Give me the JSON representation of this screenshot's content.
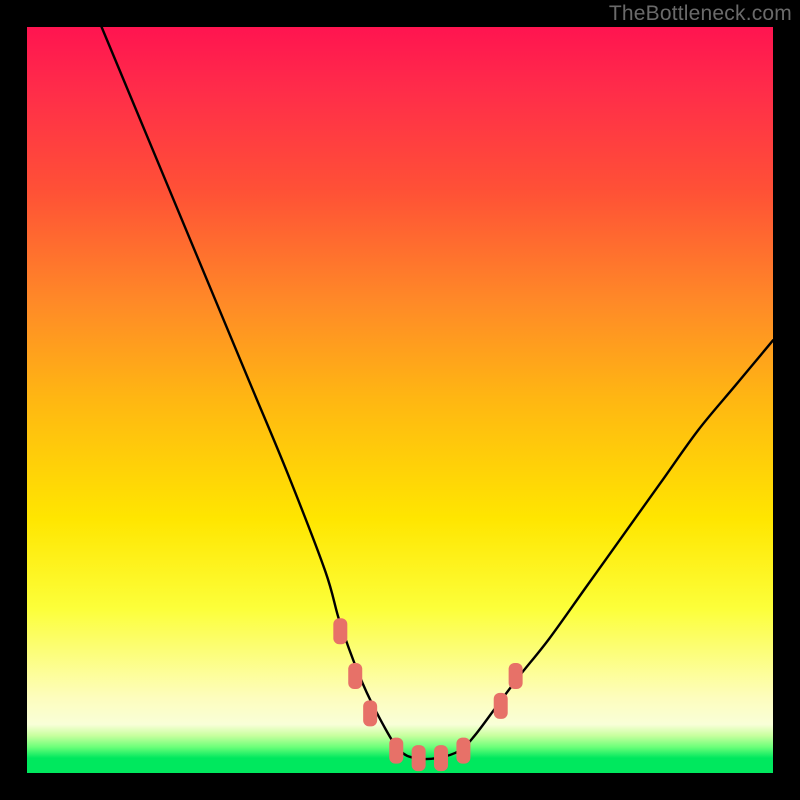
{
  "watermark": "TheBottleneck.com",
  "chart_data": {
    "type": "line",
    "title": "",
    "xlabel": "",
    "ylabel": "",
    "xlim": [
      0,
      100
    ],
    "ylim": [
      0,
      100
    ],
    "grid": false,
    "legend": false,
    "series": [
      {
        "name": "bottleneck-curve",
        "x": [
          10,
          15,
          20,
          25,
          30,
          35,
          40,
          42,
          45,
          48,
          50,
          52,
          55,
          58,
          60,
          63,
          66,
          70,
          75,
          80,
          85,
          90,
          95,
          100
        ],
        "y": [
          100,
          88,
          76,
          64,
          52,
          40,
          27,
          20,
          12,
          6,
          3,
          2,
          2,
          3,
          5,
          9,
          13,
          18,
          25,
          32,
          39,
          46,
          52,
          58
        ]
      }
    ],
    "markers": [
      {
        "name": "left-upper",
        "x": 42.0,
        "y": 19
      },
      {
        "name": "left-mid",
        "x": 44.0,
        "y": 13
      },
      {
        "name": "left-lower",
        "x": 46.0,
        "y": 8
      },
      {
        "name": "valley-left",
        "x": 49.5,
        "y": 3
      },
      {
        "name": "valley-mid1",
        "x": 52.5,
        "y": 2
      },
      {
        "name": "valley-mid2",
        "x": 55.5,
        "y": 2
      },
      {
        "name": "valley-right",
        "x": 58.5,
        "y": 3
      },
      {
        "name": "right-lower",
        "x": 63.5,
        "y": 9
      },
      {
        "name": "right-upper",
        "x": 65.5,
        "y": 13
      }
    ],
    "marker_style": {
      "color": "#e77168",
      "rx": 6,
      "width": 14,
      "height": 26
    },
    "background_gradient": {
      "top": "#ff1450",
      "mid": "#ffe600",
      "bottom": "#00e85e"
    }
  }
}
